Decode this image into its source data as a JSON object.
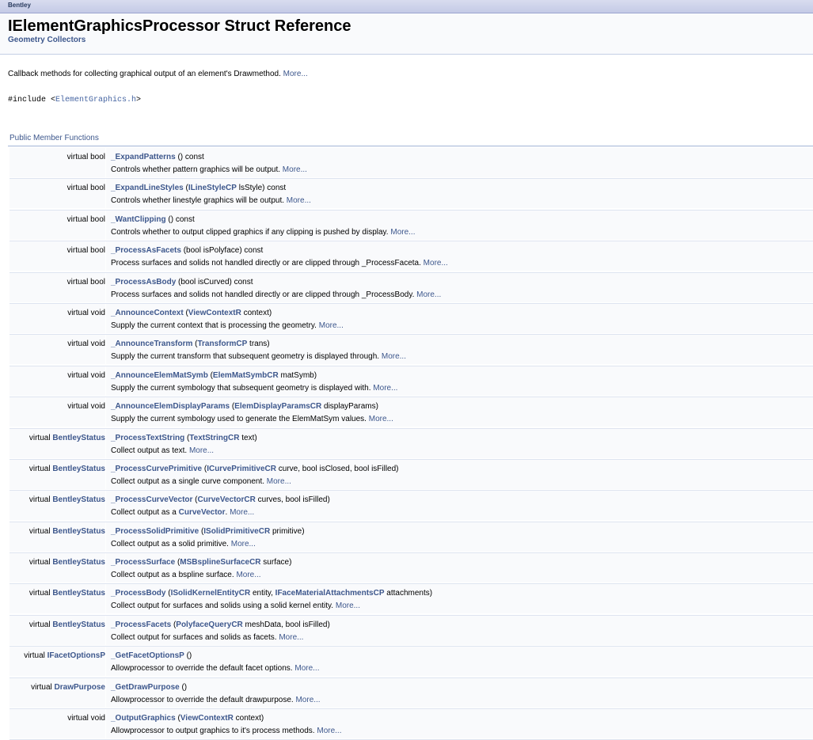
{
  "nav": {
    "item": "Bentley"
  },
  "header": {
    "title": "IElementGraphicsProcessor Struct Reference",
    "groups": [
      "Geometry",
      "Collectors"
    ]
  },
  "brief": {
    "text": "Callback methods for collecting graphical output of an element's Drawmethod.",
    "more": "More..."
  },
  "include": {
    "prefix": "#include <",
    "file": "ElementGraphics.h",
    "suffix": ">"
  },
  "section": {
    "title": "Public Member Functions"
  },
  "members": [
    {
      "ret_prefix": "virtual bool",
      "ret_link": "",
      "name": "_ExpandPatterns",
      "args": [
        {
          "t": " () const",
          "l": false
        }
      ],
      "desc": "Controls whether pattern graphics will be output."
    },
    {
      "ret_prefix": "virtual bool",
      "ret_link": "",
      "name": "_ExpandLineStyles",
      "args": [
        {
          "t": " (",
          "l": false
        },
        {
          "t": "ILineStyleCP",
          "l": true
        },
        {
          "t": " lsStyle) const",
          "l": false
        }
      ],
      "desc": "Controls whether linestyle graphics will be output."
    },
    {
      "ret_prefix": "virtual bool",
      "ret_link": "",
      "name": "_WantClipping",
      "args": [
        {
          "t": " () const",
          "l": false
        }
      ],
      "desc": "Controls whether to output clipped graphics if any clipping is pushed by display."
    },
    {
      "ret_prefix": "virtual bool",
      "ret_link": "",
      "name": "_ProcessAsFacets",
      "args": [
        {
          "t": " (bool isPolyface) const",
          "l": false
        }
      ],
      "desc": "Process surfaces and solids not handled directly or are clipped through _ProcessFaceta."
    },
    {
      "ret_prefix": "virtual bool",
      "ret_link": "",
      "name": "_ProcessAsBody",
      "args": [
        {
          "t": " (bool isCurved) const",
          "l": false
        }
      ],
      "desc": "Process surfaces and solids not handled directly or are clipped through _ProcessBody."
    },
    {
      "ret_prefix": "virtual void",
      "ret_link": "",
      "name": "_AnnounceContext",
      "args": [
        {
          "t": " (",
          "l": false
        },
        {
          "t": "ViewContextR",
          "l": true
        },
        {
          "t": " context)",
          "l": false
        }
      ],
      "desc": "Supply the current context that is processing the geometry."
    },
    {
      "ret_prefix": "virtual void",
      "ret_link": "",
      "name": "_AnnounceTransform",
      "args": [
        {
          "t": " (",
          "l": false
        },
        {
          "t": "TransformCP",
          "l": true
        },
        {
          "t": " trans)",
          "l": false
        }
      ],
      "desc": "Supply the current transform that subsequent geometry is displayed through."
    },
    {
      "ret_prefix": "virtual void",
      "ret_link": "",
      "name": "_AnnounceElemMatSymb",
      "args": [
        {
          "t": " (",
          "l": false
        },
        {
          "t": "ElemMatSymbCR",
          "l": true
        },
        {
          "t": " matSymb)",
          "l": false
        }
      ],
      "desc": "Supply the current symbology that subsequent geometry is displayed with."
    },
    {
      "ret_prefix": "virtual void",
      "ret_link": "",
      "name": "_AnnounceElemDisplayParams",
      "args": [
        {
          "t": " (",
          "l": false
        },
        {
          "t": "ElemDisplayParamsCR",
          "l": true
        },
        {
          "t": " displayParams)",
          "l": false
        }
      ],
      "desc": "Supply the current symbology used to generate the ElemMatSym values."
    },
    {
      "ret_prefix": "virtual ",
      "ret_link": "BentleyStatus",
      "name": "_ProcessTextString",
      "args": [
        {
          "t": " (",
          "l": false
        },
        {
          "t": "TextStringCR",
          "l": true
        },
        {
          "t": " text)",
          "l": false
        }
      ],
      "desc": "Collect output as text."
    },
    {
      "ret_prefix": "virtual ",
      "ret_link": "BentleyStatus",
      "name": "_ProcessCurvePrimitive",
      "args": [
        {
          "t": " (",
          "l": false
        },
        {
          "t": "ICurvePrimitiveCR",
          "l": true
        },
        {
          "t": " curve, bool isClosed, bool isFilled)",
          "l": false
        }
      ],
      "desc": "Collect output as a single curve component."
    },
    {
      "ret_prefix": "virtual ",
      "ret_link": "BentleyStatus",
      "name": "_ProcessCurveVector",
      "args": [
        {
          "t": " (",
          "l": false
        },
        {
          "t": "CurveVectorCR",
          "l": true
        },
        {
          "t": " curves, bool isFilled)",
          "l": false
        }
      ],
      "desc": "Collect output as a ",
      "desc_link": "CurveVector",
      "desc_after": "."
    },
    {
      "ret_prefix": "virtual ",
      "ret_link": "BentleyStatus",
      "name": "_ProcessSolidPrimitive",
      "args": [
        {
          "t": " (",
          "l": false
        },
        {
          "t": "ISolidPrimitiveCR",
          "l": true
        },
        {
          "t": " primitive)",
          "l": false
        }
      ],
      "desc": "Collect output as a solid primitive."
    },
    {
      "ret_prefix": "virtual ",
      "ret_link": "BentleyStatus",
      "name": "_ProcessSurface",
      "args": [
        {
          "t": " (",
          "l": false
        },
        {
          "t": "MSBsplineSurfaceCR",
          "l": true
        },
        {
          "t": " surface)",
          "l": false
        }
      ],
      "desc": "Collect output as a bspline surface."
    },
    {
      "ret_prefix": "virtual ",
      "ret_link": "BentleyStatus",
      "name": "_ProcessBody",
      "args": [
        {
          "t": " (",
          "l": false
        },
        {
          "t": "ISolidKernelEntityCR",
          "l": true
        },
        {
          "t": " entity, ",
          "l": false
        },
        {
          "t": "IFaceMaterialAttachmentsCP",
          "l": true
        },
        {
          "t": " attachments)",
          "l": false
        }
      ],
      "desc": "Collect output for surfaces and solids using a solid kernel entity."
    },
    {
      "ret_prefix": "virtual ",
      "ret_link": "BentleyStatus",
      "name": "_ProcessFacets",
      "args": [
        {
          "t": " (",
          "l": false
        },
        {
          "t": "PolyfaceQueryCR",
          "l": true
        },
        {
          "t": " meshData, bool isFilled)",
          "l": false
        }
      ],
      "desc": "Collect output for surfaces and solids as facets."
    },
    {
      "ret_prefix": "virtual ",
      "ret_link": "IFacetOptionsP",
      "name": "_GetFacetOptionsP",
      "args": [
        {
          "t": " ()",
          "l": false
        }
      ],
      "desc": "Allowprocessor to override the default facet options."
    },
    {
      "ret_prefix": "virtual ",
      "ret_link": "DrawPurpose",
      "name": "_GetDrawPurpose",
      "args": [
        {
          "t": " ()",
          "l": false
        }
      ],
      "desc": "Allowprocessor to override the default drawpurpose."
    },
    {
      "ret_prefix": "virtual void",
      "ret_link": "",
      "name": "_OutputGraphics",
      "args": [
        {
          "t": " (",
          "l": false
        },
        {
          "t": "ViewContextR",
          "l": true
        },
        {
          "t": " context)",
          "l": false
        }
      ],
      "desc": "Allowprocessor to output graphics to it's process methods."
    }
  ],
  "more_label": "More..."
}
